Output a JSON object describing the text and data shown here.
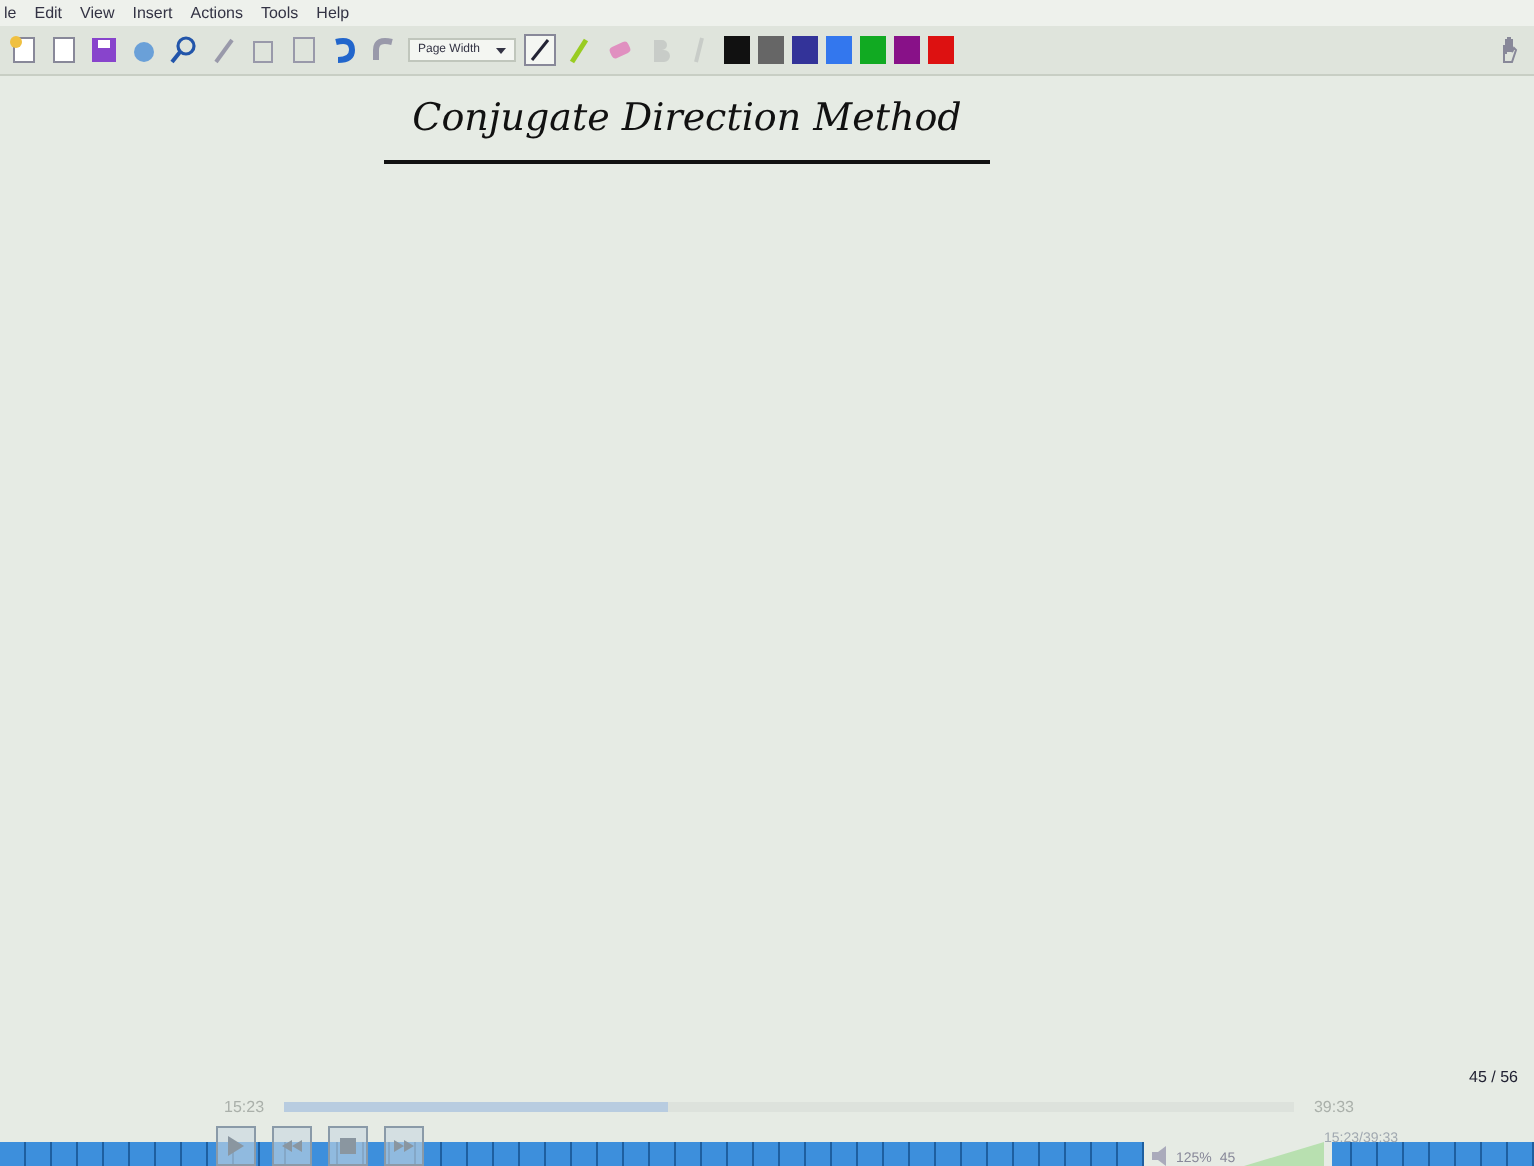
{
  "menu": [
    "le",
    "Edit",
    "View",
    "Insert",
    "Actions",
    "Tools",
    "Help"
  ],
  "toolbar": {
    "zoom": "Page Width",
    "colors": [
      {
        "color": "#111111"
      },
      {
        "color": "#666666"
      },
      {
        "color": "#333399"
      },
      {
        "color": "#3377ee"
      },
      {
        "color": "#11aa22"
      },
      {
        "color": "#881188"
      },
      {
        "color": "#dd1111"
      }
    ]
  },
  "page": {
    "title": "Conjugate Direction Method",
    "page_counter": "45 / 56"
  },
  "player": {
    "elapsed": "15:23",
    "total": "39:33",
    "level": 0.38
  },
  "taskbar": {
    "volume": "125%",
    "volume_value": "45",
    "clock": "15:23/39:33"
  }
}
